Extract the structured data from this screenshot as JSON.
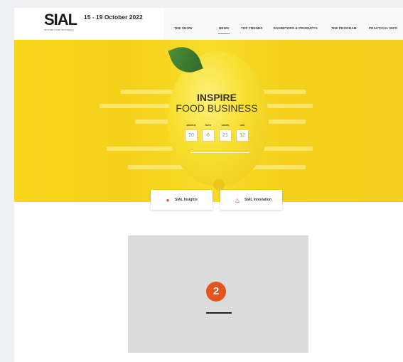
{
  "header": {
    "logo": "SIAL",
    "logo_tagline": "INSPIRE FOOD BUSINESS",
    "dates": "15 - 19 October 2022"
  },
  "nav": {
    "items": [
      {
        "label": "THE SHOW"
      },
      {
        "label": "NEWS"
      },
      {
        "label": "TOP TRENDS"
      },
      {
        "label": "EXHIBITORS & PRODUCTS"
      },
      {
        "label": "THE PROGRAM"
      },
      {
        "label": "PRACTICAL INFO"
      }
    ],
    "active": "NEWS"
  },
  "hero": {
    "title_line1": "INSPIRE",
    "title_line2": "FOOD BUSINESS",
    "countdown": [
      {
        "label": "MONTHS",
        "value": "20"
      },
      {
        "label": "DAYS",
        "value": "6"
      },
      {
        "label": "HOURS",
        "value": "21"
      },
      {
        "label": "MIN",
        "value": "12"
      }
    ]
  },
  "quick_links": [
    {
      "label": "SIAL Insights",
      "icon": "lightbulb-icon"
    },
    {
      "label": "SIAL Innovation",
      "icon": "innovation-icon"
    }
  ],
  "placeholder": {
    "badge": "2"
  },
  "colors": {
    "accent": "#e4541c",
    "nav_active": "#e9547d",
    "hero_yellow": "#f6d51b"
  }
}
